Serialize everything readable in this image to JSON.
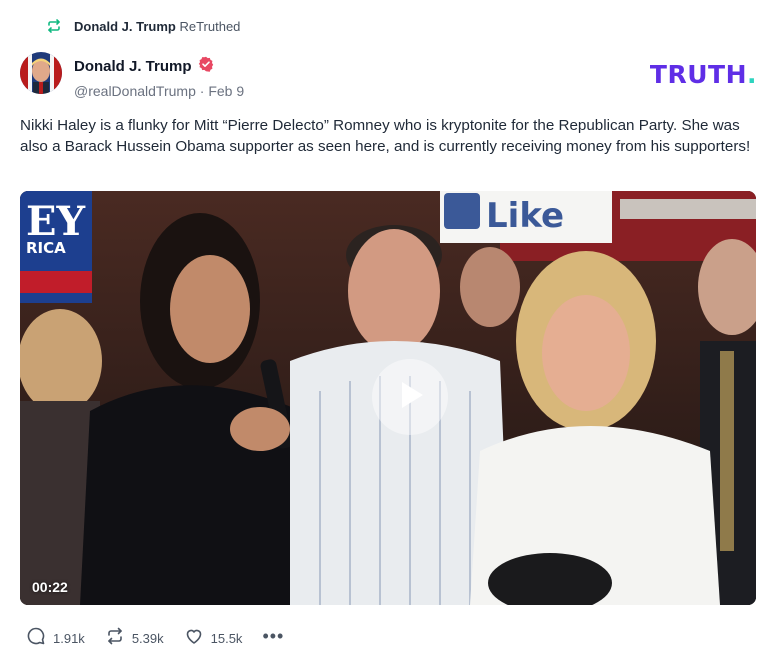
{
  "retruth": {
    "icon": "retruth-icon",
    "name": "Donald J. Trump",
    "label": "ReTruthed"
  },
  "author": {
    "display_name": "Donald J. Trump",
    "handle": "@realDonaldTrump",
    "separator": "·",
    "date": "Feb 9",
    "verified_icon": "verified-badge-icon"
  },
  "brand": {
    "logo_text": "TRUTH",
    "logo_dot": ".",
    "colors": {
      "primary": "#5f2ee6",
      "accent": "#2dd4bf",
      "verified": "#e84863"
    }
  },
  "post": {
    "text": "Nikki Haley is a flunky for Mitt “Pierre Delecto” Romney who is kryptonite for the Republican Party. She was also a Barack Hussein Obama supporter as seen here, and is currently receiving money from his supporters!"
  },
  "video": {
    "duration": "00:22",
    "play_icon": "play-icon",
    "sign_text_left": "EY",
    "sign_text_left_sub": "RICA",
    "sign_text_right": "Like"
  },
  "actions": {
    "replies": "1.91k",
    "retruths": "5.39k",
    "likes": "15.5k",
    "more_label": "•••"
  }
}
